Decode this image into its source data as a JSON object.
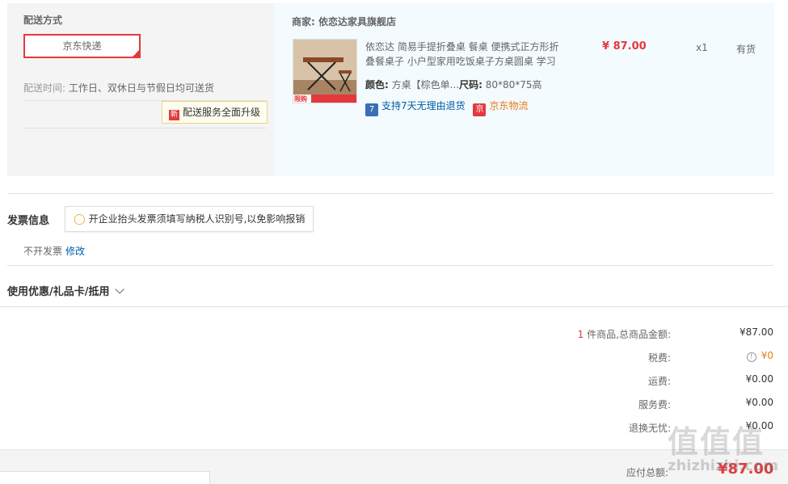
{
  "delivery": {
    "section_title": "配送方式",
    "shipping_option": "京东快递",
    "time_label": "配送时间:",
    "time_value": "工作日、双休日与节假日均可送货",
    "upgrade_badge": "新",
    "upgrade_tip": "配送服务全面升级"
  },
  "order": {
    "merchant": "商家: 依恋达家具旗舰店",
    "product_name": "依恋达 简易手提折叠桌 餐桌 便携式正方形折叠餐桌子 小户型家用吃饭桌子方桌圆桌 学习",
    "price": "¥ 87.00",
    "quantity": "x1",
    "stock": "有货",
    "color_label": "颜色:",
    "color_value": "方桌【棕色单...",
    "size_label": "尺码:",
    "size_value": "80*80*75高",
    "image_badge": "限购",
    "services": [
      {
        "icon": "7",
        "text": "支持7天无理由退货"
      },
      {
        "icon": "京",
        "text": "京东物流"
      }
    ]
  },
  "invoice": {
    "title": "发票信息",
    "tip": "开企业抬头发票须填写纳税人识别号,以免影响报销",
    "value": "不开发票",
    "edit": "修改"
  },
  "promo": {
    "title": "使用优惠/礼品卡/抵用"
  },
  "totals": {
    "count": "1",
    "items_label": "件商品,总商品金额:",
    "items_value": "¥87.00",
    "tax_label": "税费:",
    "tax_value": "¥0",
    "shipping_label": "运费:",
    "shipping_value": "¥0.00",
    "service_label": "服务费:",
    "service_value": "¥0.00",
    "return_label": "退换无忧:",
    "return_value": "¥0.00",
    "due_label": "应付总额:",
    "due_value": "¥87.00"
  },
  "watermark": {
    "text": "值值值",
    "url": "zhizhizhi.com"
  },
  "colors": {
    "accent": "#e4393c",
    "link": "#005ea7",
    "orange": "#e97c1c"
  }
}
